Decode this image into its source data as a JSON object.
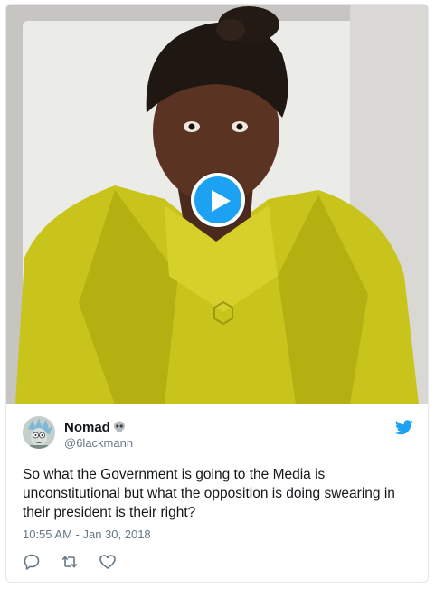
{
  "tweet": {
    "author_name": "Nomad",
    "handle": "@6lackmann",
    "text": "So what the Government is going to the Media is unconstitutional but what the opposition is doing swearing in their president is their right?",
    "timestamp": "10:55 AM - Jan 30, 2018",
    "name_emoji": "skull-icon"
  },
  "media": {
    "type": "video",
    "control": "play-icon"
  },
  "actions": [
    "reply-icon",
    "retweet-icon",
    "like-icon"
  ],
  "colors": {
    "accent": "#1da1f2",
    "text": "#14171a",
    "muted": "#657786",
    "border": "#e1e8ed"
  }
}
